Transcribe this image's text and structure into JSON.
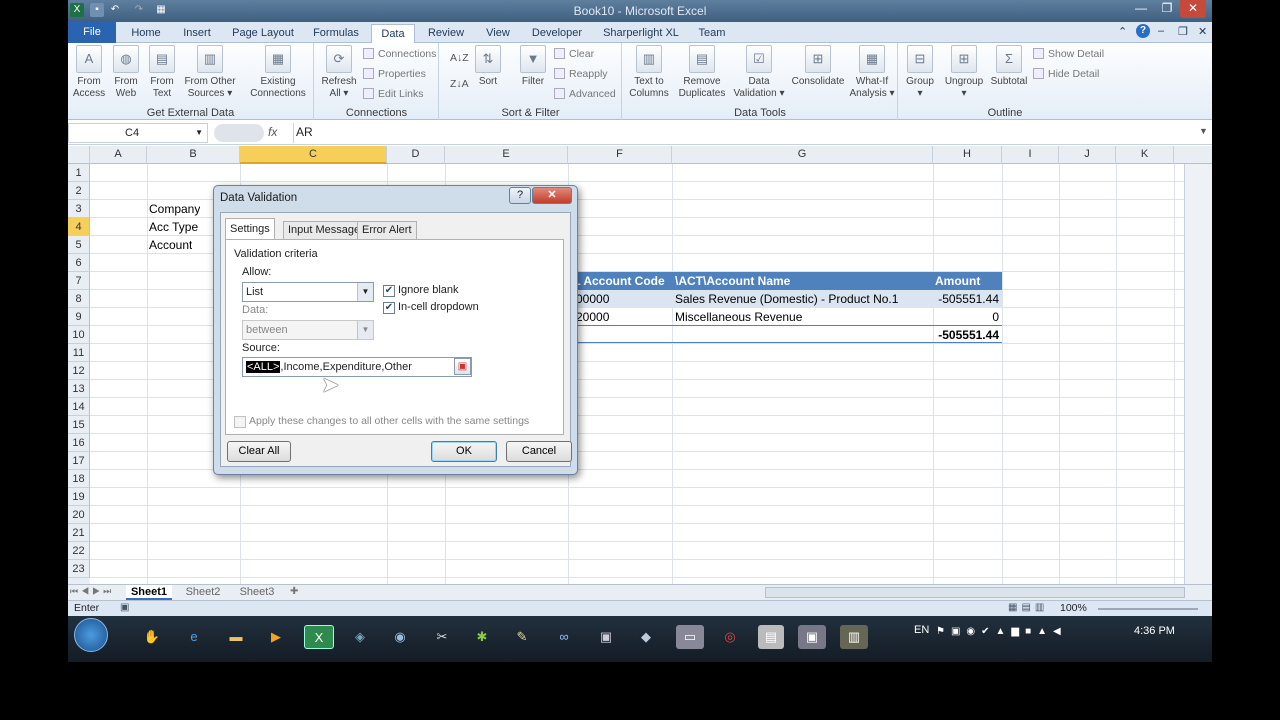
{
  "window": {
    "title": "Book10 - Microsoft Excel",
    "qat_icons": [
      "excel-icon",
      "save-icon",
      "undo-icon",
      "redo-icon",
      "print-icon"
    ]
  },
  "tabs": [
    "File",
    "Home",
    "Insert",
    "Page Layout",
    "Formulas",
    "Data",
    "Review",
    "View",
    "Developer",
    "Sharperlight XL",
    "Team"
  ],
  "active_tab": "Data",
  "ribbon": {
    "groups": {
      "get_external": "Get External Data",
      "connections": "Connections",
      "sort_filter": "Sort & Filter",
      "data_tools": "Data Tools",
      "outline": "Outline"
    },
    "buttons": {
      "from_access": [
        "From",
        "Access"
      ],
      "from_web": [
        "From",
        "Web"
      ],
      "from_text": [
        "From",
        "Text"
      ],
      "from_other": [
        "From Other",
        "Sources ▾"
      ],
      "existing": [
        "Existing",
        "Connections"
      ],
      "refresh": [
        "Refresh",
        "All ▾"
      ],
      "connections": "Connections",
      "properties": "Properties",
      "edit_links": "Edit Links",
      "sort_az": "A↓Z",
      "sort_za": "Z↓A",
      "sort": "Sort",
      "filter": "Filter",
      "clear": "Clear",
      "reapply": "Reapply",
      "advanced": "Advanced",
      "text_to_columns": [
        "Text to",
        "Columns"
      ],
      "remove_dup": [
        "Remove",
        "Duplicates"
      ],
      "data_validation": [
        "Data",
        "Validation ▾"
      ],
      "consolidate": "Consolidate",
      "what_if": [
        "What-If",
        "Analysis ▾"
      ],
      "group": [
        "Group",
        "▾"
      ],
      "ungroup": [
        "Ungroup",
        "▾"
      ],
      "subtotal": "Subtotal",
      "show_detail": "Show Detail",
      "hide_detail": "Hide Detail"
    }
  },
  "formula_bar": {
    "name_box": "C4",
    "fx": "fx",
    "value": "AR"
  },
  "columns": [
    "A",
    "B",
    "C",
    "D",
    "E",
    "F",
    "G",
    "H",
    "I",
    "J",
    "K"
  ],
  "selected_column": "C",
  "rows": [
    "1",
    "2",
    "3",
    "4",
    "5",
    "6",
    "7",
    "8",
    "9",
    "10",
    "11",
    "12",
    "13",
    "14",
    "15",
    "16",
    "17",
    "18",
    "19",
    "20",
    "21",
    "22",
    "23"
  ],
  "selected_row": "4",
  "cells": {
    "b3": "Company",
    "b4": "Acc Type",
    "b5": "Account",
    "table_headers": [
      "/L Account Code",
      "\\ACT\\Account Name",
      "Amount"
    ],
    "row8": [
      "00000",
      "Sales Revenue (Domestic) - Product No.1",
      "-505551.44"
    ],
    "row9": [
      "20000",
      "Miscellaneous Revenue",
      "0"
    ],
    "total": "-505551.44"
  },
  "sheets": [
    "Sheet1",
    "Sheet2",
    "Sheet3"
  ],
  "status": {
    "mode": "Enter",
    "zoom": "100%"
  },
  "taskbar": {
    "lang": "EN",
    "time": "4:36 PM"
  },
  "dialog": {
    "title": "Data Validation",
    "help": "?",
    "close": "✕",
    "tabs": [
      "Settings",
      "Input Message",
      "Error Alert"
    ],
    "active_tab": "Settings",
    "criteria_label": "Validation criteria",
    "allow_label": "Allow:",
    "allow_value": "List",
    "data_label": "Data:",
    "data_value": "between",
    "ignore_blank": "Ignore blank",
    "in_cell_dropdown": "In-cell dropdown",
    "source_label": "Source:",
    "source_selected": "<ALL>",
    "source_rest": ",Income,Expenditure,Other",
    "apply_all": "Apply these changes to all other cells with the same settings",
    "clear_all": "Clear All",
    "ok": "OK",
    "cancel": "Cancel"
  }
}
